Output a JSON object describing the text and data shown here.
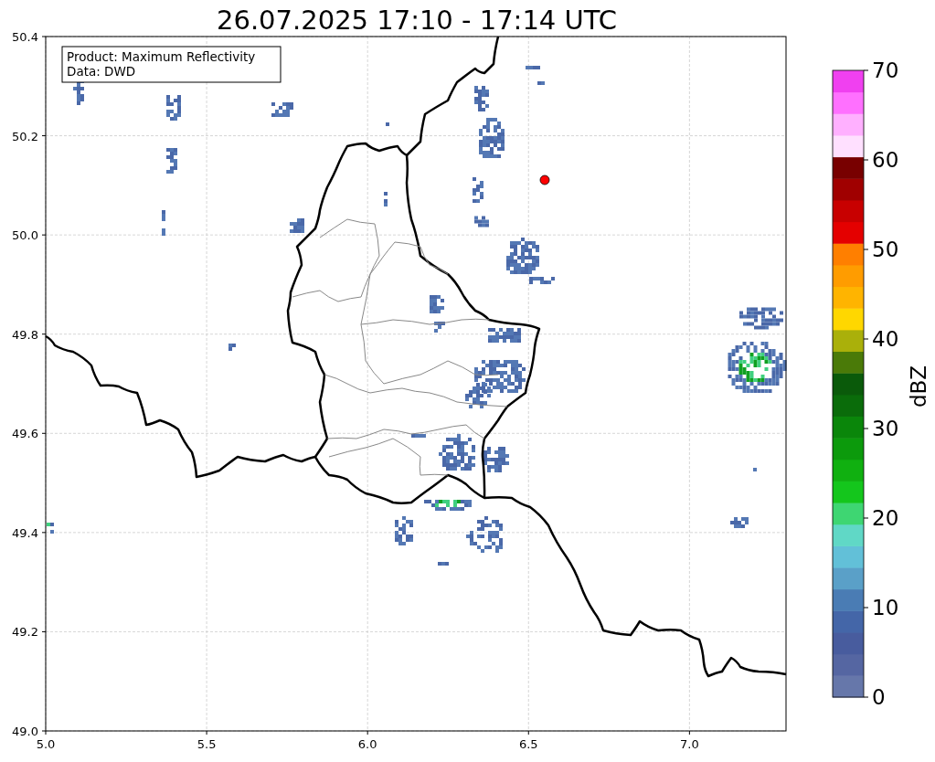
{
  "title": "26.07.2025 17:10 - 17:14 UTC",
  "legend": [
    "Product: Maximum Reflectivity",
    "Data: DWD"
  ],
  "axes": {
    "xticks": [
      "5.0",
      "5.5",
      "6.0",
      "6.5",
      "7.0"
    ],
    "yticks": [
      "50.4",
      "50.2",
      "50.0",
      "49.8",
      "49.6",
      "49.4",
      "49.2",
      "49.0"
    ]
  },
  "colorbar": {
    "label": "dBZ",
    "ticks": [
      "70",
      "60",
      "50",
      "40",
      "30",
      "20",
      "10",
      "0"
    ],
    "bands": [
      {
        "color": "#6677aa"
      },
      {
        "color": "#5566a2"
      },
      {
        "color": "#485c9e"
      },
      {
        "color": "#4466a8"
      },
      {
        "color": "#4a7cb4"
      },
      {
        "color": "#5aa0c8"
      },
      {
        "color": "#62c0d8"
      },
      {
        "color": "#60d8c6"
      },
      {
        "color": "#3ed672"
      },
      {
        "color": "#14c61c"
      },
      {
        "color": "#10b010"
      },
      {
        "color": "#0c9a0c"
      },
      {
        "color": "#0a860a"
      },
      {
        "color": "#0a6c0a"
      },
      {
        "color": "#0a5a0a"
      },
      {
        "color": "#4a7a08"
      },
      {
        "color": "#aab00a"
      },
      {
        "color": "#ffd700"
      },
      {
        "color": "#ffb400"
      },
      {
        "color": "#ff9c00"
      },
      {
        "color": "#ff7f00"
      },
      {
        "color": "#e40000"
      },
      {
        "color": "#c80000"
      },
      {
        "color": "#a00000"
      },
      {
        "color": "#780000"
      },
      {
        "color": "#ffe0ff"
      },
      {
        "color": "#ffb0ff"
      },
      {
        "color": "#ff70ff"
      },
      {
        "color": "#f040f0"
      }
    ]
  }
}
